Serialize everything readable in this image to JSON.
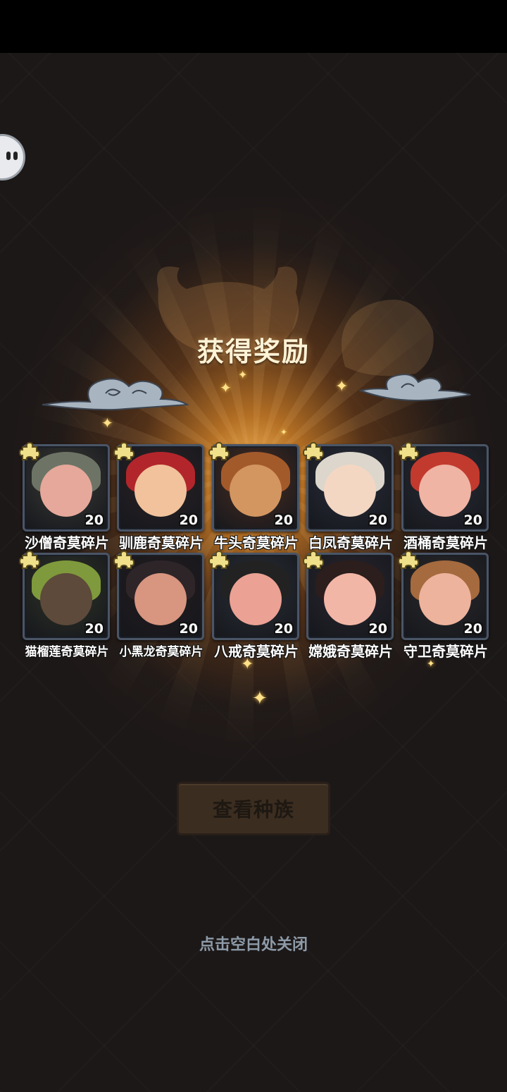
{
  "title": "获得奖励",
  "rewards": [
    {
      "name": "沙僧奇莫碎片",
      "qty": "20",
      "bg": "#3b3a36",
      "hair": "#6d7466",
      "skin": "#e6a89a"
    },
    {
      "name": "驯鹿奇莫碎片",
      "qty": "20",
      "bg": "#2c2326",
      "hair": "#b2262b",
      "skin": "#f1c29b"
    },
    {
      "name": "牛头奇莫碎片",
      "qty": "20",
      "bg": "#4a2e22",
      "hair": "#a35a2b",
      "skin": "#d39660"
    },
    {
      "name": "白凤奇莫碎片",
      "qty": "20",
      "bg": "#2b2e3b",
      "hair": "#dcd6cc",
      "skin": "#f3d7c3"
    },
    {
      "name": "酒桶奇莫碎片",
      "qty": "20",
      "bg": "#2a2c36",
      "hair": "#c23a2e",
      "skin": "#efb4a4"
    },
    {
      "name": "猫榴莲奇莫碎片",
      "qty": "20",
      "bg": "#2f3427",
      "hair": "#7f9a3c",
      "skin": "#5d4a3a"
    },
    {
      "name": "小黑龙奇莫碎片",
      "qty": "20",
      "bg": "#241c1e",
      "hair": "#2e2528",
      "skin": "#d8957f"
    },
    {
      "name": "八戒奇莫碎片",
      "qty": "20",
      "bg": "#2a2f36",
      "hair": "#222",
      "skin": "#eba193"
    },
    {
      "name": "嫦娥奇莫碎片",
      "qty": "20",
      "bg": "#2a2630",
      "hair": "#2b1e1c",
      "skin": "#f2b6a6"
    },
    {
      "name": "守卫奇莫碎片",
      "qty": "20",
      "bg": "#2c2a2c",
      "hair": "#a56a3e",
      "skin": "#eeb39c"
    }
  ],
  "view_button": "查看种族",
  "close_hint": "点击空白处关闭"
}
